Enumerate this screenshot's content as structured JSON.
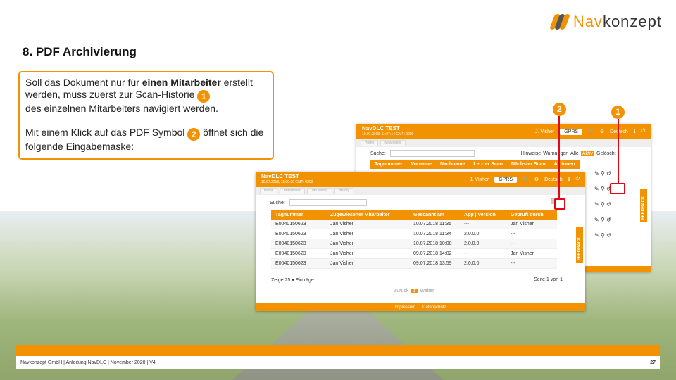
{
  "logo": {
    "prefix": "Nav",
    "suffix": "konzept"
  },
  "title": "8. PDF Archivierung",
  "textbox": {
    "p1_a": "Soll das Dokument nur für ",
    "p1_bold": "einen Mitarbeiter",
    "p1_b": " erstellt werden, muss zuerst zur Scan-Historie",
    "badge1": "1",
    "p1_c": "des einzelnen Mitarbeiters navigiert werden.",
    "p2_a": "Mit einem Klick auf das PDF Symbol",
    "badge2": "2",
    "p2_b": " öffnet sich die folgende Eingabemaske:"
  },
  "back_shot": {
    "brand": "NavDLC TEST",
    "brand_sub": "10.07.2018, 11:07:14 GMT+0200",
    "user": "J. Visher",
    "select": "GPRS",
    "lang": "Deutsch",
    "crumbs": [
      "Home",
      "Mitarbeiter"
    ],
    "search_label": "Suche:",
    "filters": [
      "Hinweise",
      "Warnungen",
      "Alle",
      "Aktiv",
      "Gelöscht"
    ],
    "columns": [
      "Tagnummer",
      "Vorname",
      "Nachname",
      "Letzter Scan",
      "Nächster Scan",
      "Aktionen"
    ],
    "feedback": "FEEDBACK"
  },
  "front_shot": {
    "brand": "NavDLC TEST",
    "brand_sub": "10.07.2018, 11:09:20 GMT+0200",
    "user": "J. Visher",
    "select": "GPRS",
    "lang": "Deutsch",
    "crumbs": [
      "Home",
      "Mitarbeiter",
      "Jan Visher",
      "History"
    ],
    "search_label": "Suche:",
    "columns": [
      "Tagnummer",
      "Zugewiesener Mitarbeiter",
      "Gescannt am",
      "App | Version",
      "Geprüft durch"
    ],
    "rows": [
      [
        "E0040150623",
        "Jan Visher",
        "10.07.2018 11:36",
        "---",
        "Jan Visher"
      ],
      [
        "E0040150623",
        "Jan Visher",
        "10.07.2018 11:34",
        "2.0.0.0",
        "---"
      ],
      [
        "E0040150623",
        "Jan Visher",
        "10.07.2018 10:08",
        "2.0.0.0",
        "---"
      ],
      [
        "E0040150623",
        "Jan Visher",
        "09.07.2018 14:02",
        "---",
        "Jan Visher"
      ],
      [
        "E0040150623",
        "Jan Visher",
        "09.07.2018 13:59",
        "2.0.0.0",
        "---"
      ]
    ],
    "show_prefix": "Zeige",
    "show_count": "25",
    "show_suffix": "Einträge",
    "page_info": "Seite 1 von 1",
    "prev": "Zurück",
    "page": "1",
    "next": "Weiter",
    "footer_links": [
      "Impressum",
      "Datenschutz"
    ],
    "feedback": "FEEDBACK"
  },
  "callouts": [
    "2",
    "1"
  ],
  "footer": {
    "text": "Navkonzept GmbH  |  Anleitung NavDLC  |  November 2020  |  V4",
    "page": "27"
  },
  "colors": {
    "accent": "#f39200",
    "highlight": "#e30613"
  }
}
